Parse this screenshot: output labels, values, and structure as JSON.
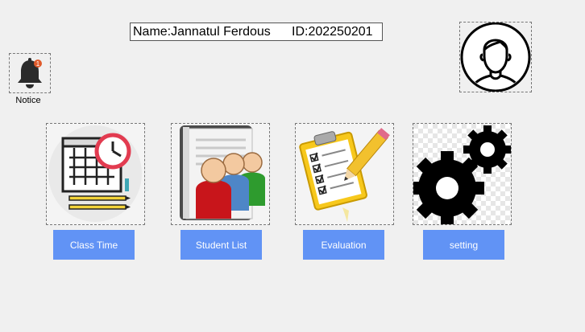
{
  "profile": {
    "name_text": "Name:Jannatul Ferdous",
    "id_text": "ID:202250201",
    "avatar_icon": "user-avatar-icon"
  },
  "notice": {
    "label": "Notice",
    "icon": "bell-icon",
    "badge_count": "1"
  },
  "tiles": [
    {
      "label": "Class Time",
      "icon": "calendar-clock-icon"
    },
    {
      "label": "Student List",
      "icon": "students-book-icon"
    },
    {
      "label": "Evaluation",
      "icon": "clipboard-checklist-icon"
    },
    {
      "label": "setting",
      "icon": "gears-icon"
    }
  ],
  "colors": {
    "button_bg": "#6193f5",
    "window_bg": "#f0f0f0",
    "badge": "#e05a2a"
  }
}
